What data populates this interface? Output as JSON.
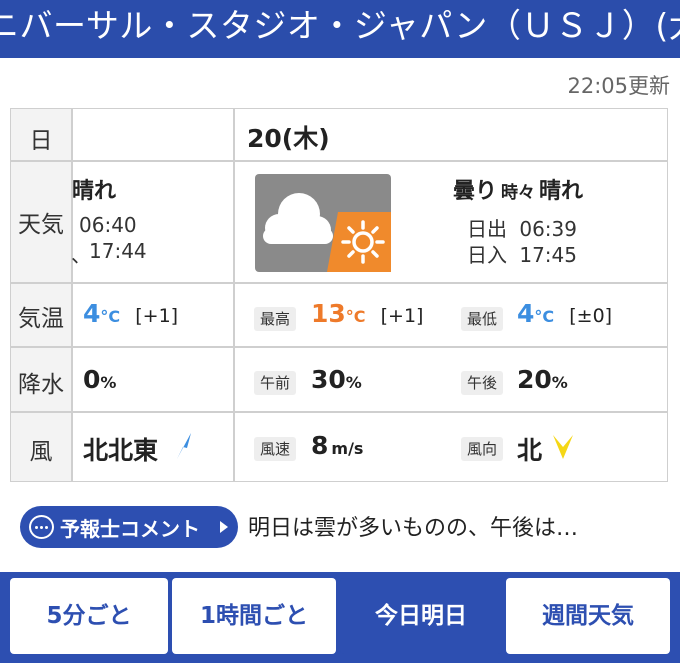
{
  "header": {
    "title": "ニバーサル・スタジオ・ジャパン（ＵＳＪ）(大阪市"
  },
  "updated": "22:05更新",
  "table": {
    "row_labels": {
      "day": "日",
      "weather": "天気",
      "temp": "気温",
      "precip": "降水",
      "wind": "風"
    },
    "left": {
      "weather": "晴れ",
      "sunrise": "06:40",
      "sunset": "17:44",
      "sunset_glyph": "、",
      "temp_value": "4",
      "temp_unit": "°C",
      "temp_diff": "[+1]",
      "precip_value": "0",
      "precip_unit": "%",
      "wind_dir": "北北東"
    },
    "right": {
      "date": "20(木)",
      "weather_main": "曇り",
      "weather_mid": "時々",
      "weather_end": "晴れ",
      "sunrise_label": "日出",
      "sunrise": "06:39",
      "sunset_label": "日入",
      "sunset": "17:45",
      "max_label": "最高",
      "max_value": "13",
      "max_unit": "°C",
      "max_diff": "[+1]",
      "min_label": "最低",
      "min_value": "4",
      "min_unit": "°C",
      "min_diff": "[±0]",
      "am_label": "午前",
      "am_value": "30",
      "am_unit": "%",
      "pm_label": "午後",
      "pm_value": "20",
      "pm_unit": "%",
      "wind_speed_label": "風速",
      "wind_speed_value": "8",
      "wind_speed_unit": "m/s",
      "wind_dir_label": "風向",
      "wind_dir": "北"
    },
    "weather_icon": "cloudy-then-sunny-icon"
  },
  "comment": {
    "button_label": "予報士コメント",
    "text": "明日は雲が多いものの、午後は…"
  },
  "tabs": [
    {
      "label": "5分ごと",
      "active": false
    },
    {
      "label": "1時間ごと",
      "active": false
    },
    {
      "label": "今日明日",
      "active": true
    },
    {
      "label": "週間天気",
      "active": false
    }
  ],
  "colors": {
    "brand": "#2d4fb1",
    "temp_low": "#3c8ee0",
    "temp_high": "#ee7a2a",
    "sun": "#f08a2c",
    "wind_arrow": "#f5d716"
  }
}
